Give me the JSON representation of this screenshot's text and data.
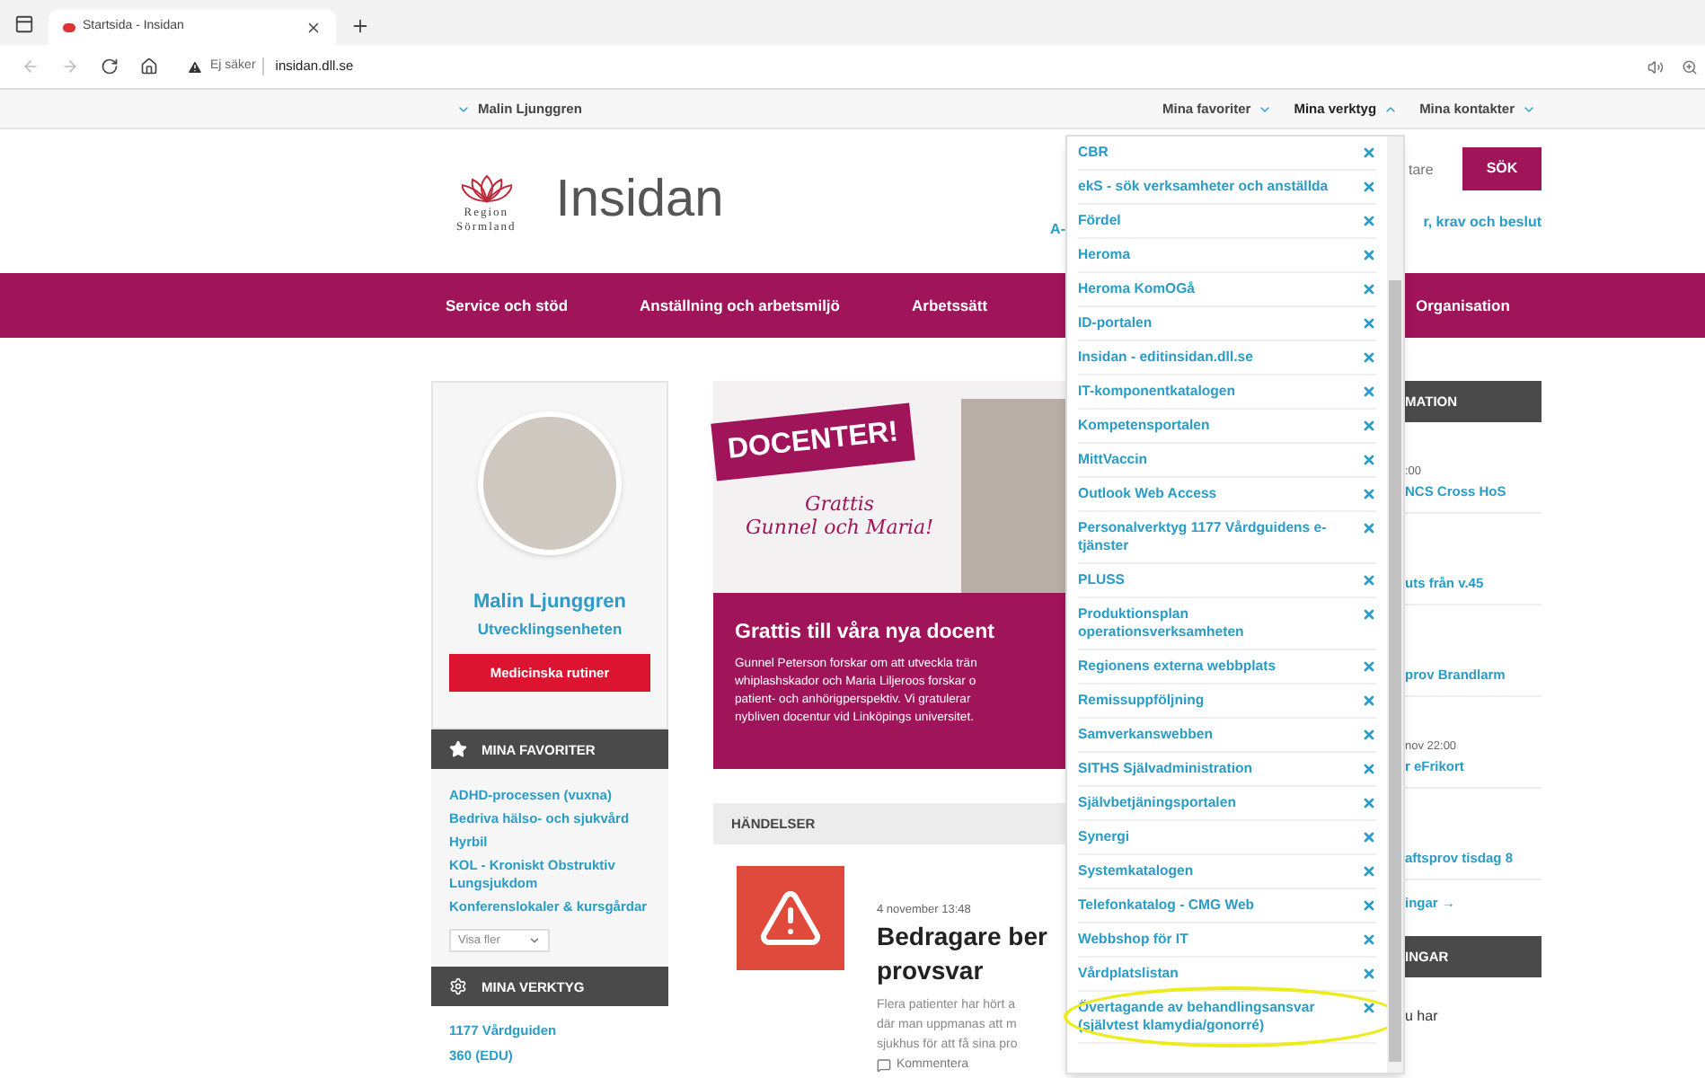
{
  "browser": {
    "tab": {
      "title": "Startsida - Insidan",
      "selected": true
    },
    "security": "Ej säker",
    "address": "insidan.dll.se"
  },
  "user_bar": {
    "user": "Malin Ljunggren",
    "menus": [
      {
        "label": "Mina favoriter",
        "expanded": false
      },
      {
        "label": "Mina verktyg",
        "expanded": true
      },
      {
        "label": "Mina kontakter",
        "expanded": false
      }
    ]
  },
  "header": {
    "site_title": "Insidan",
    "logo_text": "Region\nSörmland",
    "search": {
      "placeholder": "tare",
      "button": "SÖK"
    },
    "links": [
      "A-",
      "r, krav och beslut"
    ]
  },
  "nav": [
    "Service och stöd",
    "Anställning och arbetsmiljö",
    "Arbetssätt",
    "Organisation"
  ],
  "profile": {
    "name": "Malin Ljunggren",
    "department": "Utvecklingsenheten",
    "button": "Medicinska rutiner"
  },
  "favorites": {
    "title": "MINA FAVORITER",
    "items": [
      "ADHD-processen (vuxna)",
      "Bedriva hälso- och sjukvård",
      "Hyrbil",
      "KOL - Kroniskt Obstruktiv Lungsjukdom",
      "Konferenslokaler & kursgårdar"
    ],
    "more": "Visa fler"
  },
  "tools": {
    "title": "MINA VERKTYG",
    "items": [
      "1177 Vårdguiden",
      "360 (EDU)"
    ]
  },
  "banner": {
    "badge": "DOCENTER!",
    "script": "Grattis\nGunnel och Maria!",
    "title": "Grattis till våra nya docent",
    "text": "Gunnel Peterson forskar om att utveckla trän\nwhiplashskador och Maria Liljeroos forskar o\npatient- och anhörigperspektiv. Vi gratulerar\nnybliven docentur vid Linköpings universitet."
  },
  "events": {
    "title": "HÄNDELSER",
    "items": [
      {
        "date": "4 november 13:48",
        "title": "Bedragare ber\nprovsvar",
        "excerpt": "Flera patienter har hört a\ndär man uppmanas att m\nsjukhus för att få sina pro",
        "comment": "Kommentera"
      }
    ]
  },
  "info": {
    "title": "MATION",
    "items": [
      {
        "date": ":00",
        "title": "NCS Cross HoS"
      },
      {
        "title": "uts från v.45"
      },
      {
        "title": "prov Brandlarm"
      },
      {
        "date": "nov 22:00",
        "title": "r eFrikort"
      },
      {
        "title": "aftsprov tisdag 8"
      }
    ],
    "more": "ingar →",
    "title2": "INGAR",
    "text": "u har"
  },
  "tools_dropdown": {
    "items": [
      {
        "label": "CBR",
        "highlighted": false
      },
      {
        "label": "ekS - sök verksamheter och anställda",
        "highlighted": false
      },
      {
        "label": "Fördel",
        "highlighted": false
      },
      {
        "label": "Heroma",
        "highlighted": false
      },
      {
        "label": "Heroma KomOGå",
        "highlighted": false
      },
      {
        "label": "ID-portalen",
        "highlighted": false
      },
      {
        "label": "Insidan - editinsidan.dll.se",
        "highlighted": false
      },
      {
        "label": "IT-komponentkatalogen",
        "highlighted": false
      },
      {
        "label": "Kompetensportalen",
        "highlighted": false
      },
      {
        "label": "MittVaccin",
        "highlighted": false
      },
      {
        "label": "Outlook Web Access",
        "highlighted": false
      },
      {
        "label": "Personalverktyg 1177 Vårdguidens e-tjänster",
        "highlighted": false
      },
      {
        "label": "PLUSS",
        "highlighted": false
      },
      {
        "label": "Produktionsplan operationsverksamheten",
        "highlighted": false
      },
      {
        "label": "Regionens externa webbplats",
        "highlighted": false
      },
      {
        "label": "Remissuppföljning",
        "highlighted": false
      },
      {
        "label": "Samverkanswebben",
        "highlighted": false
      },
      {
        "label": "SITHS Självadministration",
        "highlighted": false
      },
      {
        "label": "Självbetjäningsportalen",
        "highlighted": false
      },
      {
        "label": "Synergi",
        "highlighted": false
      },
      {
        "label": "Systemkatalogen",
        "highlighted": false
      },
      {
        "label": "Telefonkatalog - CMG Web",
        "highlighted": false
      },
      {
        "label": "Webbshop för IT",
        "highlighted": false
      },
      {
        "label": "Vårdplatslistan",
        "highlighted": false
      },
      {
        "label": "Övertagande av behandlingsansvar (självtest klamydia/gonorré)",
        "highlighted": true
      }
    ]
  }
}
